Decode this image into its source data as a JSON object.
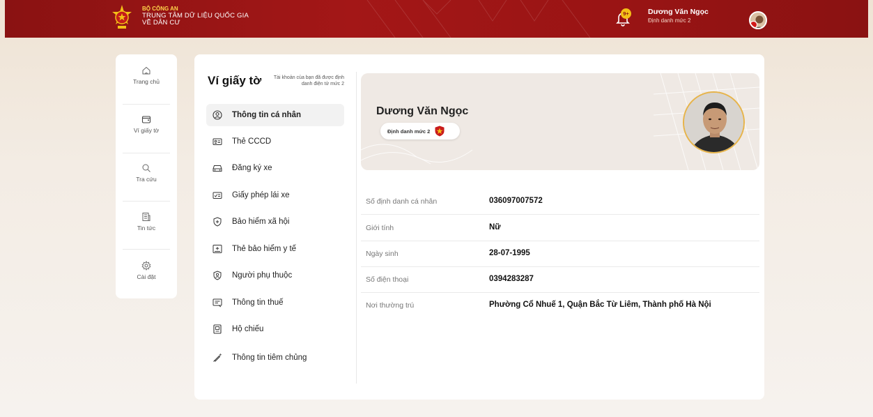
{
  "header": {
    "org_line1": "BỘ CÔNG AN",
    "org_line2": "TRUNG TÂM DỮ LIỆU QUỐC GIA",
    "org_line3": "VỀ DÂN CƯ",
    "notification_badge": "9+",
    "user_name": "Dương Văn Ngọc",
    "user_level": "Định danh mức 2"
  },
  "leftnav": {
    "items": [
      {
        "label": "Trang chủ",
        "icon": "home-icon"
      },
      {
        "label": "Ví giấy tờ",
        "icon": "wallet-icon"
      },
      {
        "label": "Tra cứu",
        "icon": "search-icon"
      },
      {
        "label": "Tin tức",
        "icon": "news-icon"
      },
      {
        "label": "Cài đặt",
        "icon": "gear-icon"
      }
    ]
  },
  "menu": {
    "title": "Ví giấy tờ",
    "note": "Tài khoản của bạn đã được định danh điện tử mức 2",
    "items": [
      {
        "label": "Thông tin cá nhân",
        "icon": "user-circle-icon"
      },
      {
        "label": "Thẻ CCCD",
        "icon": "id-card-icon"
      },
      {
        "label": "Đăng ký xe",
        "icon": "car-icon"
      },
      {
        "label": "Giấy phép lái xe",
        "icon": "license-icon"
      },
      {
        "label": "Bảo hiểm xã hội",
        "icon": "shield-plus-icon"
      },
      {
        "label": "Thẻ bảo hiểm y tế",
        "icon": "health-card-icon"
      },
      {
        "label": "Người phụ thuộc",
        "icon": "dependent-icon"
      },
      {
        "label": "Thông tin thuế",
        "icon": "tax-icon"
      },
      {
        "label": "Hộ chiếu",
        "icon": "passport-icon"
      },
      {
        "label": "Thông tin tiêm chủng",
        "icon": "syringe-icon"
      }
    ]
  },
  "profile": {
    "name": "Dương Văn Ngọc",
    "level": "Định danh mức 2"
  },
  "info": [
    {
      "key": "Số định danh cá nhân",
      "value": "036097007572"
    },
    {
      "key": "Giới tính",
      "value": "Nữ"
    },
    {
      "key": "Ngày sinh",
      "value": "28-07-1995"
    },
    {
      "key": "Số điện thoại",
      "value": "0394283287"
    },
    {
      "key": "Nơi thường trú",
      "value": "Phường Cổ Nhuế 1, Quận Bắc Từ Liêm, Thành phố Hà Nội"
    }
  ],
  "colors": {
    "header_red": "#9a1414",
    "accent_gold": "#f3c017",
    "active_menu_bg": "#f2f2f2"
  }
}
